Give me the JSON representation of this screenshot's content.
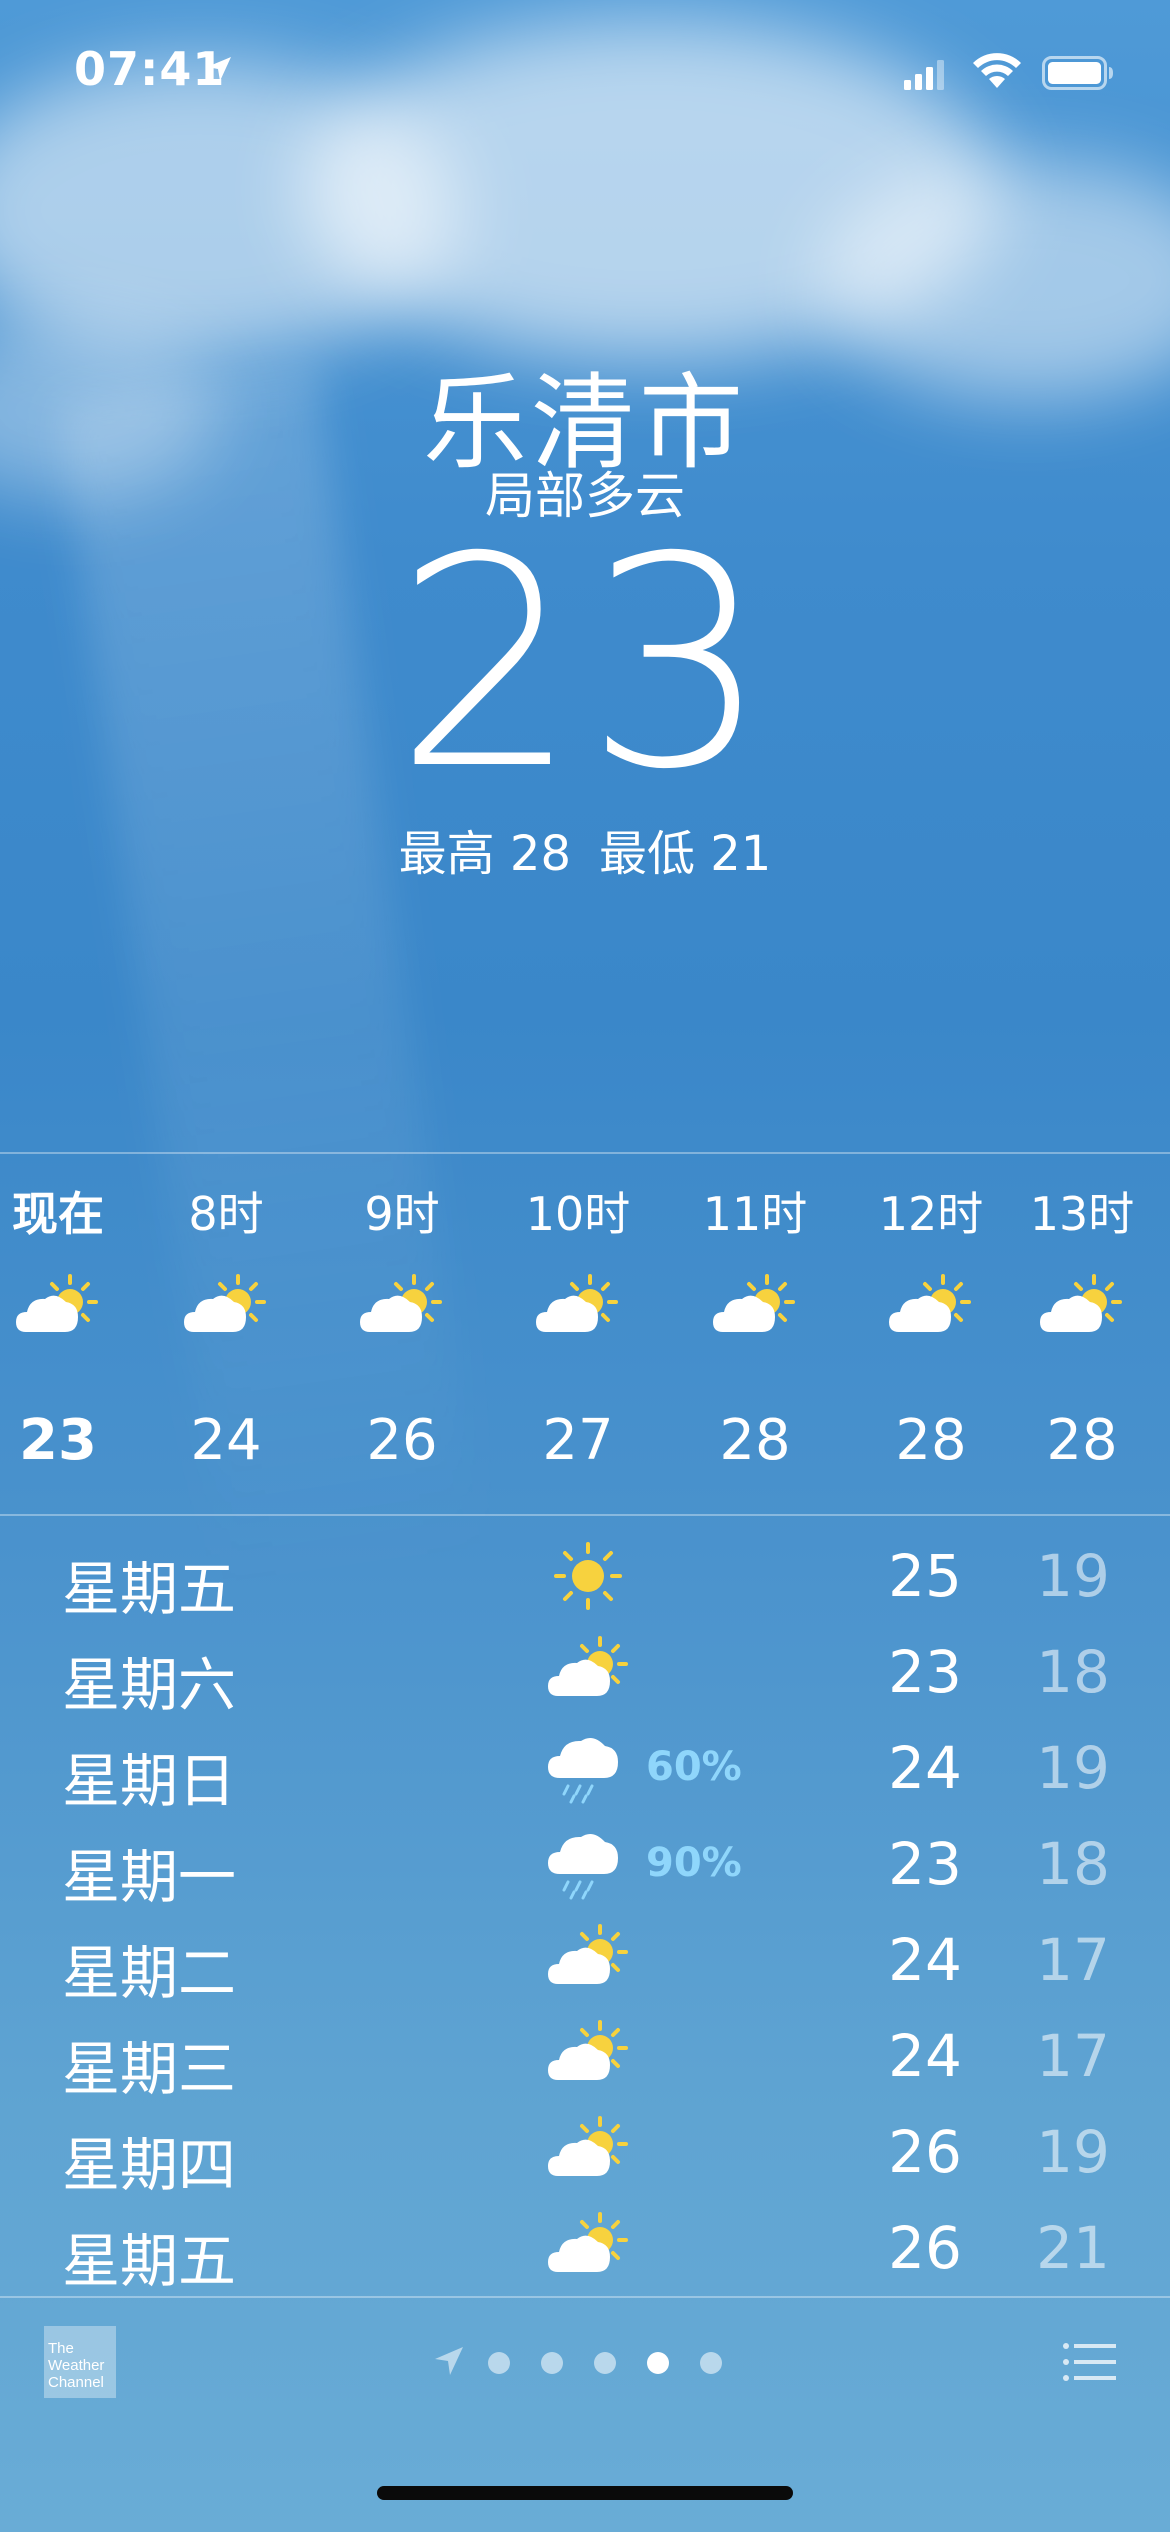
{
  "status_bar": {
    "time": "07:41"
  },
  "location": {
    "city": "乐清市",
    "condition": "局部多云",
    "temperature": "23",
    "high": "最高 28",
    "low": "最低 21"
  },
  "hourly": [
    {
      "label": "现在",
      "icon": "partly-cloudy-day-icon",
      "temp": "23"
    },
    {
      "label": "8时",
      "icon": "partly-cloudy-day-icon",
      "temp": "24"
    },
    {
      "label": "9时",
      "icon": "partly-cloudy-day-icon",
      "temp": "26"
    },
    {
      "label": "10时",
      "icon": "partly-cloudy-day-icon",
      "temp": "27"
    },
    {
      "label": "11时",
      "icon": "partly-cloudy-day-icon",
      "temp": "28"
    },
    {
      "label": "12时",
      "icon": "partly-cloudy-day-icon",
      "temp": "28"
    },
    {
      "label": "13时",
      "icon": "partly-cloudy-day-icon",
      "temp": "28"
    }
  ],
  "daily": [
    {
      "day": "星期五",
      "icon": "sunny-icon",
      "pop": "",
      "high": "25",
      "low": "19"
    },
    {
      "day": "星期六",
      "icon": "partly-cloudy-day-icon",
      "pop": "",
      "high": "23",
      "low": "18"
    },
    {
      "day": "星期日",
      "icon": "rain-icon",
      "pop": "60%",
      "high": "24",
      "low": "19"
    },
    {
      "day": "星期一",
      "icon": "rain-icon",
      "pop": "90%",
      "high": "23",
      "low": "18"
    },
    {
      "day": "星期二",
      "icon": "partly-cloudy-day-icon",
      "pop": "",
      "high": "24",
      "low": "17"
    },
    {
      "day": "星期三",
      "icon": "partly-cloudy-day-icon",
      "pop": "",
      "high": "24",
      "low": "17"
    },
    {
      "day": "星期四",
      "icon": "partly-cloudy-day-icon",
      "pop": "",
      "high": "26",
      "low": "19"
    },
    {
      "day": "星期五",
      "icon": "partly-cloudy-day-icon",
      "pop": "",
      "high": "26",
      "low": "21"
    }
  ],
  "footer": {
    "logo_text": [
      "The",
      "Weather",
      "Channel"
    ],
    "page_count": 5,
    "active_page": 4
  },
  "colors": {
    "precipitation": "#8fd6fb",
    "sun": "#f7d23e"
  }
}
